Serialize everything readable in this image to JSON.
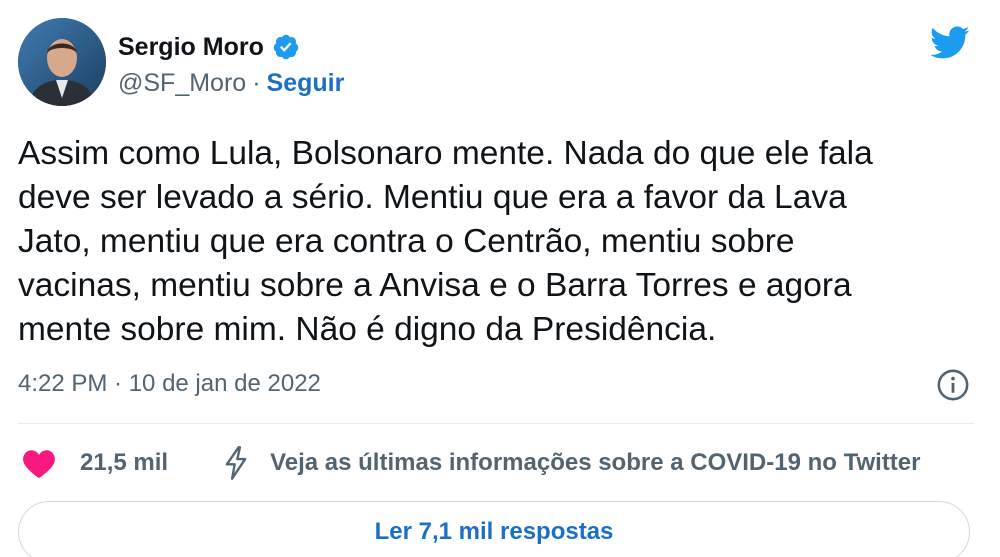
{
  "author": {
    "name": "Sergio Moro",
    "handle": "@SF_Moro",
    "separator": "·",
    "follow_label": "Seguir",
    "verified_icon": "verified-badge-icon",
    "avatar_icon": "profile-photo"
  },
  "brand": {
    "icon": "twitter-bird-icon",
    "color": "#1d9bf0"
  },
  "tweet": {
    "text": "Assim como Lula, Bolsonaro mente. Nada do que ele fala\ndeve ser levado a sério. Mentiu que era a favor da Lava\nJato, mentiu que era contra o Centrão, mentiu sobre\nvacinas, mentiu sobre a Anvisa e o Barra Torres e agora\nmente sobre mim. Não é digno da Presidência.",
    "timestamp": "4:22 PM · 10 de jan de 2022"
  },
  "actions": {
    "likes": "21,5 mil",
    "covid_label": "Veja as últimas informações sobre a COVID-19 no Twitter",
    "like_color": "#f91880"
  },
  "replies": {
    "label": "Ler 7,1 mil respostas"
  }
}
